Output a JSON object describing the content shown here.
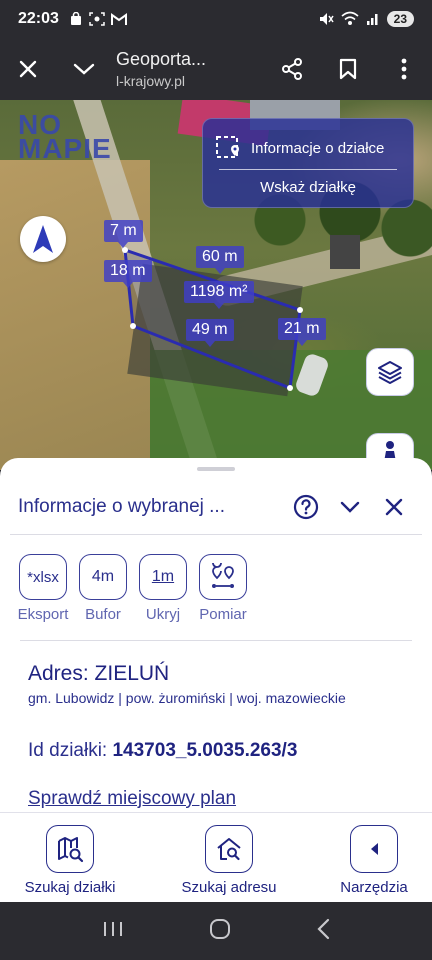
{
  "status_bar": {
    "time": "22:03",
    "battery": "23"
  },
  "browser": {
    "title": "Geoporta...",
    "url": "l-krajowy.pl"
  },
  "map": {
    "logo_line1": "NO",
    "logo_line2": "MAPIE",
    "info_panel": {
      "title": "Informacje o działce",
      "action": "Wskaż działkę"
    },
    "measurements": [
      "7 m",
      "60 m",
      "18 m",
      "1198 m²",
      "49 m",
      "21 m"
    ]
  },
  "sheet": {
    "title": "Informacje o wybranej ...",
    "tools": [
      {
        "icon_text": "*xlsx",
        "label": "Eksport"
      },
      {
        "icon_text": "4m",
        "label": "Bufor"
      },
      {
        "icon_text": "1m",
        "label": "Ukryj"
      },
      {
        "icon_text": "",
        "label": "Pomiar"
      }
    ],
    "address": "Adres: ZIELUŃ",
    "admin": "gm. Lubowidz | pow. żuromiński | woj. mazowieckie",
    "id_label": "Id działki:",
    "id_value": "143703_5.0035.263/3",
    "plan_link": "Sprawdź miejscowy plan"
  },
  "bottom_nav": [
    {
      "label": "Szukaj działki",
      "icon": "map-search-icon"
    },
    {
      "label": "Szukaj adresu",
      "icon": "home-search-icon"
    },
    {
      "label": "Narzędzia",
      "icon": "chevron-left-icon"
    }
  ],
  "colors": {
    "primary": "#2a2f8c",
    "panel": "#2830a0",
    "measure_label": "#403ec8"
  }
}
